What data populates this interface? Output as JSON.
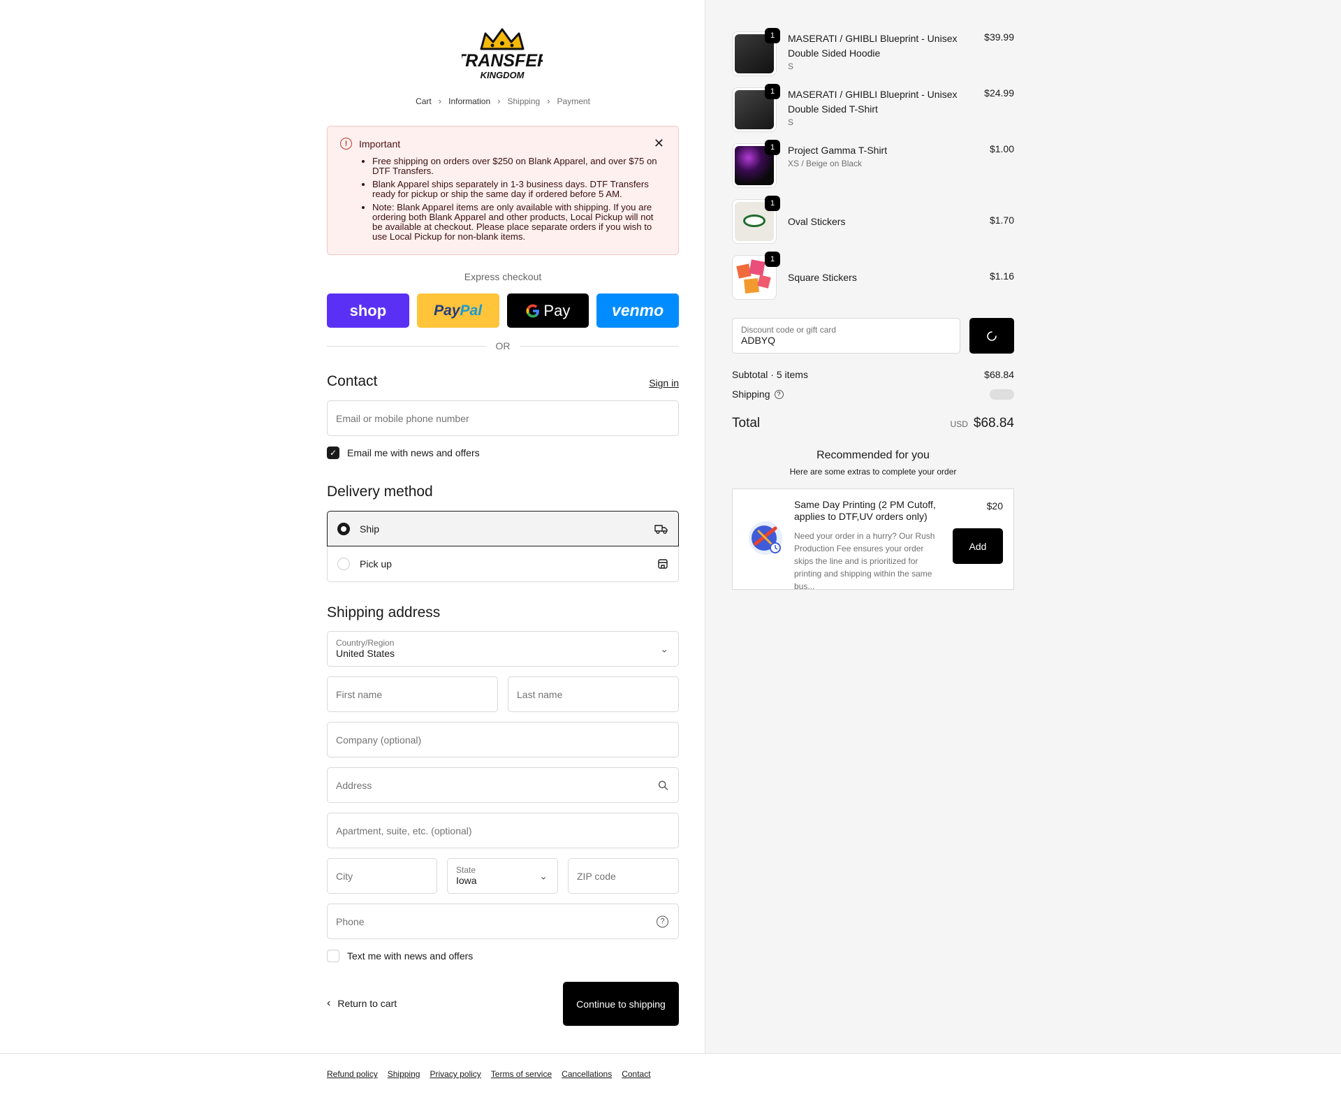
{
  "brand": {
    "logo_line1": "TRANSFER",
    "logo_line2": "KINGDOM"
  },
  "breadcrumb": [
    "Cart",
    "Information",
    "Shipping",
    "Payment"
  ],
  "banner": {
    "title": "Important",
    "items": [
      "Free shipping on orders over $250 on Blank Apparel, and over $75 on DTF Transfers.",
      "Blank Apparel ships separately in 1-3 business days. DTF Transfers ready for pickup or ship the same day if ordered before 5 AM.",
      "Note: Blank Apparel items are only available with shipping. If you are ordering both Blank Apparel and other products, Local Pickup will not be available at checkout. Please place separate orders if you wish to use Local Pickup for non-blank items."
    ]
  },
  "express": {
    "title": "Express checkout",
    "shop": "shop",
    "paypal_1": "Pay",
    "paypal_2": "Pal",
    "gpay": "Pay",
    "venmo": "venmo",
    "or": "OR"
  },
  "contact": {
    "heading": "Contact",
    "sign_in": "Sign in",
    "email_placeholder": "Email or mobile phone number",
    "news_label": "Email me with news and offers",
    "news_checked": true
  },
  "delivery": {
    "heading": "Delivery method",
    "ship": "Ship",
    "pickup": "Pick up"
  },
  "shipping": {
    "heading": "Shipping address",
    "country_label": "Country/Region",
    "country_value": "United States",
    "first_name": "First name",
    "last_name": "Last name",
    "company": "Company (optional)",
    "address": "Address",
    "apartment": "Apartment, suite, etc. (optional)",
    "city": "City",
    "state_label": "State",
    "state_value": "Iowa",
    "zip": "ZIP code",
    "phone": "Phone",
    "text_label": "Text me with news and offers"
  },
  "actions": {
    "return": "Return to cart",
    "continue": "Continue to shipping"
  },
  "footer": [
    "Refund policy",
    "Shipping",
    "Privacy policy",
    "Terms of service",
    "Cancellations",
    "Contact"
  ],
  "cart": {
    "items": [
      {
        "name": "MASERATI / GHIBLI Blueprint - Unisex Double Sided Hoodie",
        "variant": "S",
        "price": "$39.99",
        "qty": "1"
      },
      {
        "name": "MASERATI / GHIBLI Blueprint - Unisex Double Sided T-Shirt",
        "variant": "S",
        "price": "$24.99",
        "qty": "1"
      },
      {
        "name": "Project Gamma T-Shirt",
        "variant": "XS / Beige on Black",
        "price": "$1.00",
        "qty": "1"
      },
      {
        "name": "Oval Stickers",
        "variant": "",
        "price": "$1.70",
        "qty": "1"
      },
      {
        "name": "Square Stickers",
        "variant": "",
        "price": "$1.16",
        "qty": "1"
      }
    ],
    "discount_label": "Discount code or gift card",
    "discount_value": "ADBYQ",
    "subtotal_label": "Subtotal · 5 items",
    "subtotal_value": "$68.84",
    "shipping_label": "Shipping",
    "total_label": "Total",
    "total_currency": "USD",
    "total_value": "$68.84"
  },
  "recommend": {
    "title": "Recommended for you",
    "subtitle": "Here are some extras to complete your order",
    "product_title": "Same Day Printing (2 PM Cutoff, applies to DTF,UV orders only)",
    "product_price": "$20",
    "product_desc": "Need your order in a hurry? Our Rush Production Fee ensures your order skips the line and is prioritized for printing and shipping within the same bus...",
    "add": "Add"
  }
}
